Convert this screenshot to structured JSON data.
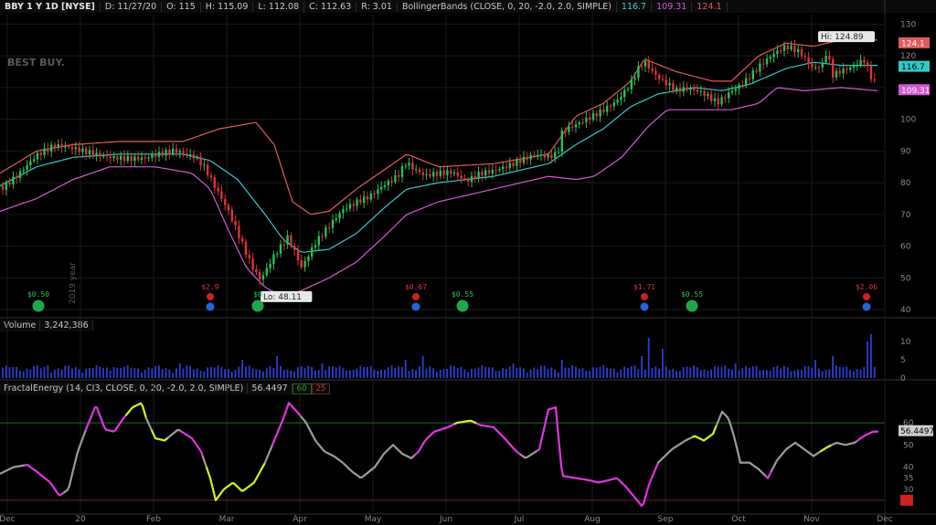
{
  "header": {
    "symbol": "BBY 1 Y 1D [NYSE]",
    "date": "D: 11/27/20",
    "open": "O: 115",
    "high": "H: 115.09",
    "low": "L: 112.08",
    "close": "C: 112.63",
    "range": "R: 3.01",
    "study": "BollingerBands (CLOSE, 0, 20, -2.0, 2.0, SIMPLE)",
    "bb_mid": "116.7",
    "bb_lower": "109.31",
    "bb_upper": "124.1"
  },
  "logo_text": "BEST BUY.",
  "year_label": "2019 year",
  "volume_header": {
    "label": "Volume",
    "value": "3,242,386"
  },
  "fe_header": {
    "label": "FractalEnergy (14, CI3, CLOSE, 0, 20, -2.0, 2.0, SIMPLE)",
    "value": "56.4497",
    "upper": "60",
    "lower": "25"
  },
  "colors": {
    "up": "#26c15a",
    "down": "#e0323a",
    "bb_upper": "#e25a5a",
    "bb_mid": "#33c9c9",
    "bb_lower": "#d35ad3",
    "volume": "#2a3fd1",
    "fe_gray": "#9a9a9a",
    "fe_magenta": "#e033e0",
    "fe_yellow": "#d4f01e"
  },
  "chart_data": [
    {
      "type": "line",
      "name_panel": "price",
      "months": [
        "Dec",
        "20",
        "Feb",
        "Mar",
        "Apr",
        "May",
        "Jun",
        "Jul",
        "Aug",
        "Sep",
        "Oct",
        "Nov",
        "Dec"
      ],
      "y_ticks": [
        "130",
        "120",
        "110",
        "100",
        "90",
        "80",
        "70",
        "60",
        "50",
        "40"
      ],
      "ylim": [
        38,
        133
      ],
      "close_anchors": [
        [
          0,
          79
        ],
        [
          20,
          83
        ],
        [
          40,
          88
        ],
        [
          60,
          90.5
        ],
        [
          80,
          90
        ],
        [
          100,
          89.5
        ],
        [
          130,
          89
        ],
        [
          160,
          88
        ],
        [
          190,
          89
        ],
        [
          215,
          87
        ],
        [
          225,
          84
        ],
        [
          235,
          79
        ],
        [
          250,
          72
        ],
        [
          265,
          62
        ],
        [
          275,
          55
        ],
        [
          285,
          50
        ],
        [
          300,
          57
        ],
        [
          315,
          62
        ],
        [
          330,
          52
        ],
        [
          345,
          60
        ],
        [
          360,
          66
        ],
        [
          375,
          72
        ],
        [
          390,
          75
        ],
        [
          405,
          77
        ],
        [
          420,
          80
        ],
        [
          435,
          82
        ],
        [
          445,
          86
        ],
        [
          450,
          84
        ],
        [
          465,
          81
        ],
        [
          480,
          82
        ],
        [
          495,
          83
        ],
        [
          510,
          81
        ],
        [
          525,
          84
        ],
        [
          540,
          85
        ],
        [
          555,
          86
        ],
        [
          570,
          87
        ],
        [
          585,
          88
        ],
        [
          600,
          87
        ],
        [
          610,
          88
        ],
        [
          615,
          95
        ],
        [
          630,
          98
        ],
        [
          645,
          101
        ],
        [
          660,
          104
        ],
        [
          675,
          107
        ],
        [
          690,
          112
        ],
        [
          700,
          117
        ],
        [
          705,
          118
        ],
        [
          715,
          114
        ],
        [
          725,
          111
        ],
        [
          740,
          108
        ],
        [
          755,
          109
        ],
        [
          770,
          108
        ],
        [
          785,
          106
        ],
        [
          800,
          110
        ],
        [
          815,
          113
        ],
        [
          830,
          117
        ],
        [
          845,
          120
        ],
        [
          860,
          122
        ],
        [
          875,
          120
        ],
        [
          890,
          115
        ],
        [
          900,
          117
        ],
        [
          905,
          122
        ],
        [
          910,
          114
        ],
        [
          920,
          116
        ],
        [
          935,
          118
        ],
        [
          945,
          120
        ],
        [
          955,
          113
        ],
        [
          960,
          112
        ]
      ],
      "bb_upper_anchors": [
        [
          0,
          83
        ],
        [
          40,
          90
        ],
        [
          80,
          92
        ],
        [
          130,
          93
        ],
        [
          200,
          93
        ],
        [
          240,
          97
        ],
        [
          280,
          99
        ],
        [
          300,
          92
        ],
        [
          320,
          74
        ],
        [
          340,
          70
        ],
        [
          360,
          71
        ],
        [
          390,
          78
        ],
        [
          420,
          84
        ],
        [
          445,
          89
        ],
        [
          480,
          85
        ],
        [
          540,
          86
        ],
        [
          600,
          89
        ],
        [
          630,
          101
        ],
        [
          660,
          105
        ],
        [
          690,
          112
        ],
        [
          705,
          119
        ],
        [
          740,
          115
        ],
        [
          780,
          112
        ],
        [
          800,
          112
        ],
        [
          830,
          120
        ],
        [
          860,
          124
        ],
        [
          890,
          123
        ],
        [
          920,
          125
        ],
        [
          960,
          125
        ]
      ],
      "bb_mid_anchors": [
        [
          0,
          79
        ],
        [
          40,
          85
        ],
        [
          80,
          88
        ],
        [
          130,
          89
        ],
        [
          200,
          89
        ],
        [
          230,
          87
        ],
        [
          260,
          81
        ],
        [
          290,
          70
        ],
        [
          310,
          62
        ],
        [
          330,
          58
        ],
        [
          360,
          59
        ],
        [
          390,
          64
        ],
        [
          420,
          72
        ],
        [
          445,
          78
        ],
        [
          480,
          80
        ],
        [
          540,
          82
        ],
        [
          600,
          86
        ],
        [
          630,
          92
        ],
        [
          660,
          97
        ],
        [
          690,
          104
        ],
        [
          720,
          108
        ],
        [
          760,
          110
        ],
        [
          790,
          109
        ],
        [
          820,
          111
        ],
        [
          860,
          116
        ],
        [
          890,
          118
        ],
        [
          920,
          117
        ],
        [
          960,
          117
        ]
      ],
      "bb_lower_anchors": [
        [
          0,
          71
        ],
        [
          40,
          75
        ],
        [
          80,
          81
        ],
        [
          120,
          85
        ],
        [
          170,
          85
        ],
        [
          210,
          83
        ],
        [
          230,
          78
        ],
        [
          250,
          65
        ],
        [
          270,
          53
        ],
        [
          290,
          47
        ],
        [
          310,
          44
        ],
        [
          330,
          46
        ],
        [
          360,
          50
        ],
        [
          390,
          55
        ],
        [
          420,
          63
        ],
        [
          445,
          70
        ],
        [
          480,
          74
        ],
        [
          540,
          78
        ],
        [
          600,
          82
        ],
        [
          630,
          81
        ],
        [
          650,
          82
        ],
        [
          680,
          88
        ],
        [
          710,
          98
        ],
        [
          730,
          103
        ],
        [
          760,
          103
        ],
        [
          800,
          103
        ],
        [
          830,
          105
        ],
        [
          850,
          110
        ],
        [
          880,
          109
        ],
        [
          920,
          110
        ],
        [
          960,
          109
        ]
      ],
      "annotations": [
        {
          "label": "Hi: 124.89",
          "x_day": 895,
          "y": 124.89
        },
        {
          "label": "Lo: 48.11",
          "x_day": 290,
          "y": 48.11
        }
      ],
      "events": [
        {
          "x_day": 42,
          "label": "$0.50",
          "kind": "dividend"
        },
        {
          "x_day": 230,
          "label": "$2.9",
          "kind": "earnings"
        },
        {
          "x_day": 282,
          "label": "$0",
          "kind": "dividend"
        },
        {
          "x_day": 455,
          "label": "$0.67",
          "kind": "earnings"
        },
        {
          "x_day": 506,
          "label": "$0.55",
          "kind": "dividend"
        },
        {
          "x_day": 705,
          "label": "$1.71",
          "kind": "earnings"
        },
        {
          "x_day": 757,
          "label": "$0.55",
          "kind": "dividend"
        },
        {
          "x_day": 948,
          "label": "$2.06",
          "kind": "earnings"
        }
      ]
    },
    {
      "type": "bar",
      "name_panel": "volume",
      "y_ticks": [
        "10",
        "5",
        "0"
      ],
      "ylim": [
        0,
        12
      ],
      "spikes": [
        [
          50,
          3.5
        ],
        [
          120,
          3
        ],
        [
          195,
          4
        ],
        [
          262,
          5
        ],
        [
          300,
          6
        ],
        [
          350,
          4
        ],
        [
          440,
          5
        ],
        [
          460,
          6
        ],
        [
          560,
          4
        ],
        [
          612,
          5
        ],
        [
          700,
          6
        ],
        [
          706,
          11
        ],
        [
          722,
          8
        ],
        [
          800,
          4
        ],
        [
          890,
          5
        ],
        [
          910,
          6
        ],
        [
          945,
          10
        ],
        [
          950,
          12
        ]
      ]
    },
    {
      "type": "line",
      "name_panel": "fractal_energy",
      "y_ticks": [
        "60",
        "50",
        "40",
        "35",
        "30",
        "25"
      ],
      "ylim": [
        20,
        72
      ],
      "anchors": [
        [
          0,
          37
        ],
        [
          15,
          40
        ],
        [
          30,
          41
        ],
        [
          40,
          38
        ],
        [
          55,
          33
        ],
        [
          65,
          27
        ],
        [
          75,
          30
        ],
        [
          85,
          47
        ],
        [
          95,
          58
        ],
        [
          105,
          68
        ],
        [
          115,
          57
        ],
        [
          125,
          56
        ],
        [
          135,
          62
        ],
        [
          145,
          67
        ],
        [
          155,
          69
        ],
        [
          160,
          62
        ],
        [
          170,
          53
        ],
        [
          180,
          52
        ],
        [
          195,
          57
        ],
        [
          210,
          53
        ],
        [
          220,
          47
        ],
        [
          230,
          35
        ],
        [
          236,
          25
        ],
        [
          245,
          30
        ],
        [
          255,
          33
        ],
        [
          265,
          29
        ],
        [
          278,
          33
        ],
        [
          290,
          42
        ],
        [
          300,
          52
        ],
        [
          310,
          62
        ],
        [
          316,
          69
        ],
        [
          325,
          65
        ],
        [
          335,
          60
        ],
        [
          345,
          52
        ],
        [
          355,
          47
        ],
        [
          365,
          45
        ],
        [
          375,
          42
        ],
        [
          385,
          38
        ],
        [
          395,
          35
        ],
        [
          410,
          40
        ],
        [
          420,
          46
        ],
        [
          430,
          50
        ],
        [
          440,
          46
        ],
        [
          450,
          44
        ],
        [
          458,
          47
        ],
        [
          465,
          52
        ],
        [
          475,
          56
        ],
        [
          490,
          58
        ],
        [
          500,
          60
        ],
        [
          515,
          61
        ],
        [
          525,
          59
        ],
        [
          540,
          58
        ],
        [
          552,
          53
        ],
        [
          565,
          47
        ],
        [
          575,
          44
        ],
        [
          590,
          48
        ],
        [
          600,
          66
        ],
        [
          608,
          67
        ],
        [
          615,
          36
        ],
        [
          630,
          35
        ],
        [
          645,
          34
        ],
        [
          655,
          33
        ],
        [
          665,
          34
        ],
        [
          675,
          35
        ],
        [
          685,
          31
        ],
        [
          695,
          26
        ],
        [
          703,
          22
        ],
        [
          710,
          32
        ],
        [
          720,
          42
        ],
        [
          735,
          48
        ],
        [
          750,
          52
        ],
        [
          760,
          54
        ],
        [
          770,
          52
        ],
        [
          780,
          55
        ],
        [
          790,
          65
        ],
        [
          797,
          62
        ],
        [
          803,
          54
        ],
        [
          810,
          42
        ],
        [
          820,
          42
        ],
        [
          830,
          39
        ],
        [
          840,
          35
        ],
        [
          850,
          43
        ],
        [
          860,
          48
        ],
        [
          870,
          51
        ],
        [
          880,
          48
        ],
        [
          890,
          45
        ],
        [
          905,
          49
        ],
        [
          915,
          51
        ],
        [
          925,
          50
        ],
        [
          935,
          51
        ],
        [
          945,
          54
        ],
        [
          955,
          56
        ],
        [
          960,
          56
        ]
      ],
      "yellow_ranges": [
        [
          140,
          160
        ],
        [
          168,
          185
        ],
        [
          228,
          290
        ],
        [
          500,
          522
        ],
        [
          760,
          785
        ],
        [
          900,
          910
        ]
      ],
      "magenta_ranges": [
        [
          30,
          70
        ],
        [
          95,
          140
        ],
        [
          200,
          222
        ],
        [
          300,
          330
        ],
        [
          455,
          500
        ],
        [
          522,
          570
        ],
        [
          590,
          720
        ],
        [
          840,
          845
        ],
        [
          940,
          960
        ]
      ]
    }
  ]
}
